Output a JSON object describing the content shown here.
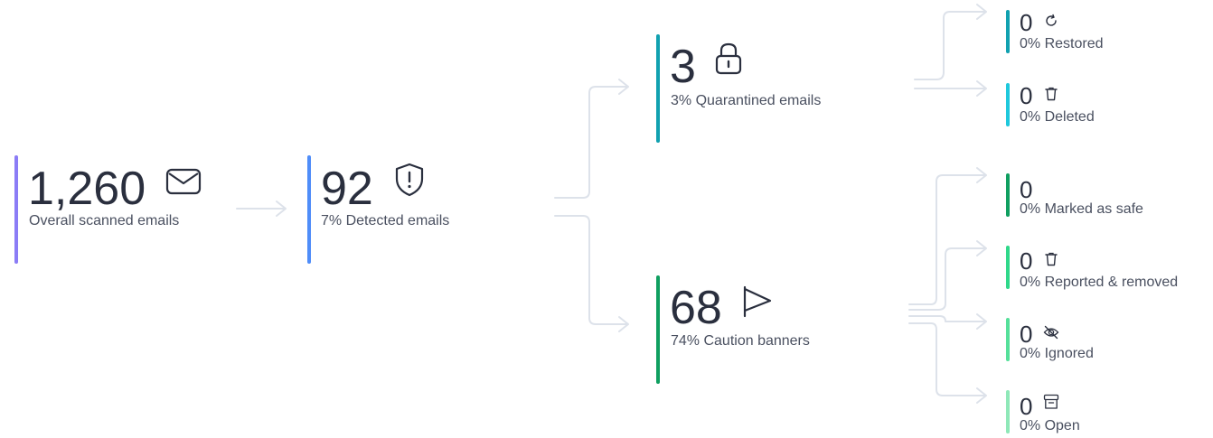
{
  "colors": {
    "connector": "#dde2ea",
    "overall": "#8b7cf6",
    "detected": "#4f8df9",
    "quarantined": "#11a1b0",
    "caution": "#0f9f60",
    "restored": "#11a1b0",
    "deleted": "#1ec8dc",
    "marked_safe": "#0f9f60",
    "reported_removed": "#2fd88a",
    "ignored": "#55e09a",
    "open": "#8fe8b8"
  },
  "overall": {
    "value": "1,260",
    "label": "Overall scanned emails",
    "icon": "envelope-icon"
  },
  "detected": {
    "value": "92",
    "label": "7% Detected emails",
    "icon": "shield-alert-icon"
  },
  "quarantined": {
    "value": "3",
    "label": "3% Quarantined emails",
    "icon": "lock-icon"
  },
  "caution": {
    "value": "68",
    "label": "74% Caution banners",
    "icon": "flag-icon"
  },
  "restored": {
    "value": "0",
    "label": "0% Restored",
    "icon": "refresh-icon"
  },
  "deleted": {
    "value": "0",
    "label": "0% Deleted",
    "icon": "trash-icon"
  },
  "marked_safe": {
    "value": "0",
    "label": "0% Marked as safe"
  },
  "reported_removed": {
    "value": "0",
    "label": "0% Reported & removed",
    "icon": "trash-icon"
  },
  "ignored": {
    "value": "0",
    "label": "0% Ignored",
    "icon": "eye-off-icon"
  },
  "open": {
    "value": "0",
    "label": "0% Open",
    "icon": "archive-icon"
  }
}
